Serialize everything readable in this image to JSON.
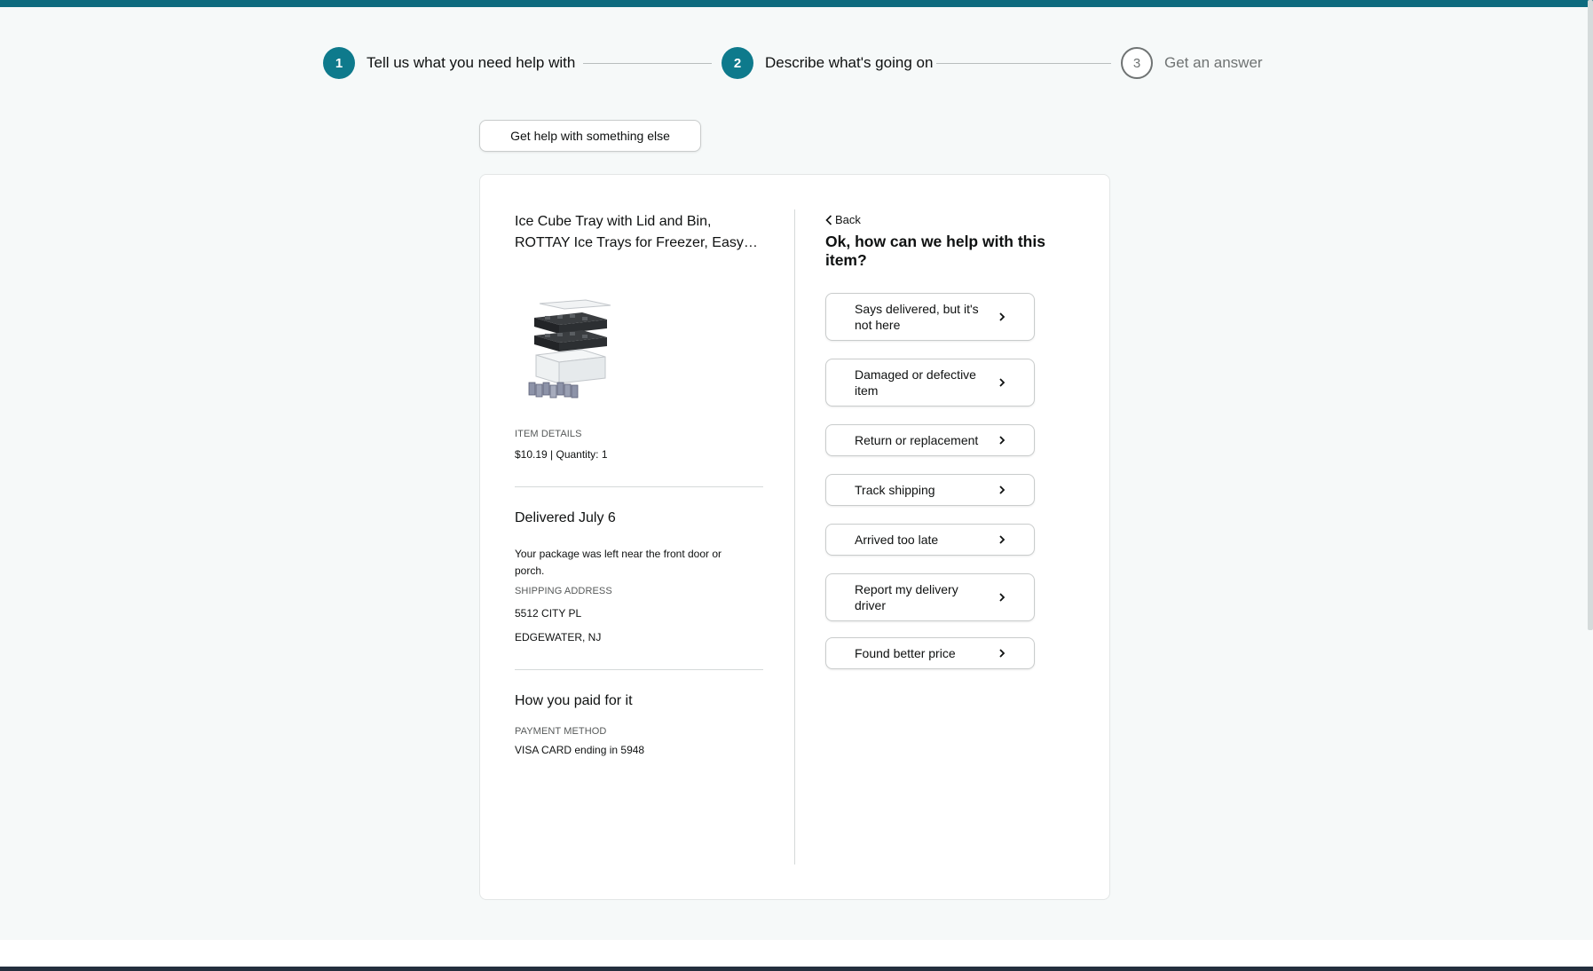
{
  "stepper": {
    "steps": [
      {
        "number": "1",
        "label": "Tell us what you need help with"
      },
      {
        "number": "2",
        "label": "Describe what's going on"
      },
      {
        "number": "3",
        "label": "Get an answer"
      }
    ]
  },
  "top_button_label": "Get help with something else",
  "item": {
    "title_line1": "Ice Cube Tray with Lid and Bin,",
    "title_line2": "ROTTAY Ice Trays for Freezer, Easy-...",
    "details_label": "ITEM DETAILS",
    "price_quantity": "$10.19 | Quantity: 1"
  },
  "delivery": {
    "title": "Delivered July 6",
    "note_line1": "Your package was left near the front door or",
    "note_line2": "porch.",
    "address_label": "SHIPPING ADDRESS",
    "address_line1": "5512 CITY PL",
    "address_line2": "EDGEWATER, NJ"
  },
  "payment": {
    "title": "How you paid for it",
    "method_label": "PAYMENT METHOD",
    "method_value": "VISA CARD ending in 5948"
  },
  "help": {
    "back_label": "Back",
    "title": "Ok, how can we help with this item?",
    "options": [
      {
        "line1": "Says delivered, but it's",
        "line2": "not here"
      },
      {
        "line1": "Damaged or defective",
        "line2": "item"
      },
      {
        "line1": "Return or replacement",
        "line2": ""
      },
      {
        "line1": "Track shipping",
        "line2": ""
      },
      {
        "line1": "Arrived too late",
        "line2": ""
      },
      {
        "line1": "Report my delivery",
        "line2": "driver"
      },
      {
        "line1": "Found better price",
        "line2": ""
      }
    ]
  },
  "colors": {
    "accent": "#0e7a8c",
    "top_bar": "#0e6b7f",
    "background": "#f6f9f9"
  }
}
